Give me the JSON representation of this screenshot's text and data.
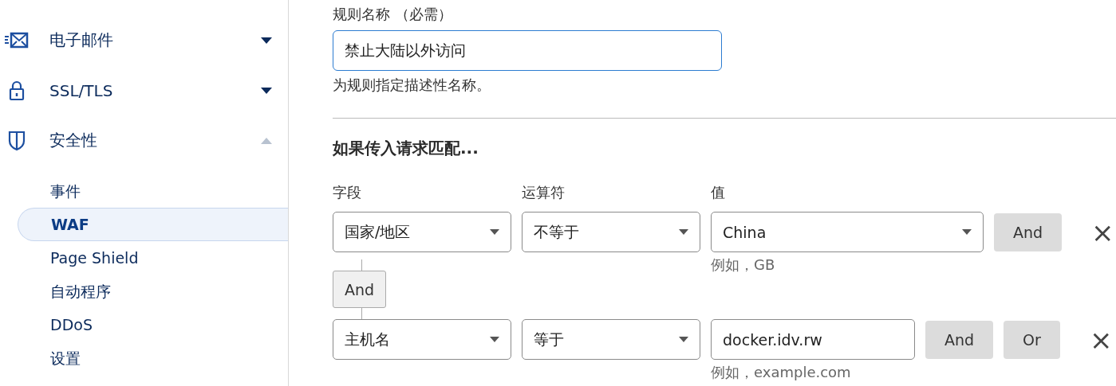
{
  "sidebar": {
    "groups": [
      {
        "label": "电子邮件",
        "expanded": false
      },
      {
        "label": "SSL/TLS",
        "expanded": false
      },
      {
        "label": "安全性",
        "expanded": true,
        "items": [
          {
            "label": "事件",
            "selected": false
          },
          {
            "label": "WAF",
            "selected": true
          },
          {
            "label": "Page Shield",
            "selected": false
          },
          {
            "label": "自动程序",
            "selected": false
          },
          {
            "label": "DDoS",
            "selected": false
          },
          {
            "label": "设置",
            "selected": false
          }
        ]
      }
    ]
  },
  "rule_name": {
    "label": "规则名称 （必需）",
    "value": "禁止大陆以外访问",
    "help": "为规则指定描述性名称。"
  },
  "match": {
    "heading": "如果传入请求匹配...",
    "columns": [
      "字段",
      "运算符",
      "值"
    ],
    "rows": [
      {
        "field": "国家/地区",
        "operator": "不等于",
        "value": {
          "kind": "select",
          "text": "China"
        },
        "hint": "例如，GB",
        "buttons": [
          "And"
        ],
        "remove": "×"
      },
      {
        "field": "主机名",
        "operator": "等于",
        "value": {
          "kind": "input",
          "text": "docker.idv.rw"
        },
        "hint": "例如，example.com",
        "buttons": [
          "And",
          "Or"
        ],
        "remove": "×"
      }
    ],
    "connectors": [
      "And"
    ]
  }
}
